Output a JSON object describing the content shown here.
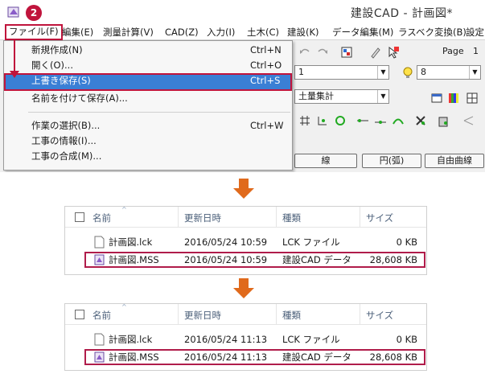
{
  "app": {
    "title": "建設CAD - 計画図*",
    "step_badge": "2",
    "menu": [
      {
        "label": "ファイル(F)",
        "active": true
      },
      {
        "label": "編集(E)"
      },
      {
        "label": "測量計算(V)"
      },
      {
        "label": "CAD(Z)"
      },
      {
        "label": "入力(I)"
      },
      {
        "label": "土木(C)"
      },
      {
        "label": "建設(K)"
      },
      {
        "label": "データ編集(M)"
      },
      {
        "label": "ラスベク変換(B)"
      },
      {
        "label": "設定"
      }
    ],
    "file_menu": [
      {
        "label": "新規作成(N)",
        "shortcut": "Ctrl+N"
      },
      {
        "label": "開く(O)...",
        "shortcut": "Ctrl+O"
      },
      {
        "label": "上書き保存(S)",
        "shortcut": "Ctrl+S",
        "highlighted": true
      },
      {
        "label": "名前を付けて保存(A)...",
        "shortcut": ""
      },
      {
        "label": "作業の選択(B)...",
        "shortcut": "Ctrl+W"
      },
      {
        "label": "工事の情報(I)...",
        "shortcut": ""
      },
      {
        "label": "工事の合成(M)...",
        "shortcut": ""
      }
    ],
    "toolbar": {
      "page_label": "Page",
      "page_value": "1",
      "line_combo_value": "1",
      "layer_combo_value": "8",
      "layer_name_combo": "土量集計"
    },
    "draw_buttons": [
      "線",
      "円(弧)",
      "自由曲線"
    ],
    "colors": {
      "accent": "#c0143c",
      "highlight": "#3a7fd5",
      "arrow": "#e06a1c"
    }
  },
  "explorer_columns": {
    "name": "名前",
    "modified": "更新日時",
    "type": "種類",
    "size": "サイズ"
  },
  "explorer_before": [
    {
      "name": "計画図.lck",
      "modified": "2016/05/24 10:59",
      "type": "LCK ファイル",
      "size": "0 KB",
      "icon": "document-icon"
    },
    {
      "name": "計画図.MSS",
      "modified": "2016/05/24 10:59",
      "type": "建設CAD データ",
      "size": "28,608 KB",
      "icon": "cad-file-icon",
      "boxed": true
    }
  ],
  "explorer_after": [
    {
      "name": "計画図.lck",
      "modified": "2016/05/24 11:13",
      "type": "LCK ファイル",
      "size": "0 KB",
      "icon": "document-icon"
    },
    {
      "name": "計画図.MSS",
      "modified": "2016/05/24 11:13",
      "type": "建設CAD データ",
      "size": "28,608 KB",
      "icon": "cad-file-icon",
      "boxed": true
    }
  ]
}
